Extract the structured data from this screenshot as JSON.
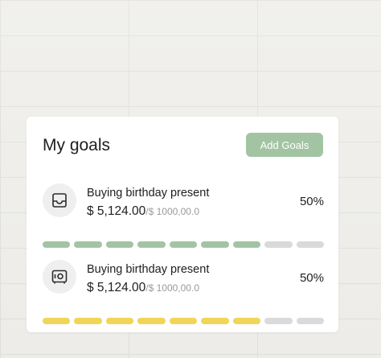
{
  "card": {
    "title": "My goals",
    "add_button": "Add Goals"
  },
  "goals": [
    {
      "icon": "inbox-tray-icon",
      "name": "Buying birthday present",
      "current": "$ 5,124.00",
      "target": "/$ 1000,00.0",
      "percent": "50%",
      "progress_filled_segments": 7,
      "total_segments": 9,
      "fill_color": "#a3c4a3"
    },
    {
      "icon": "safe-icon",
      "name": "Buying birthday present",
      "current": "$ 5,124.00",
      "target": "/$ 1000,00.0",
      "percent": "50%",
      "progress_filled_segments": 7,
      "total_segments": 9,
      "fill_color": "#f0d558"
    }
  ],
  "colors": {
    "empty_segment": "#dadada",
    "button_bg": "#a3c4a3"
  }
}
